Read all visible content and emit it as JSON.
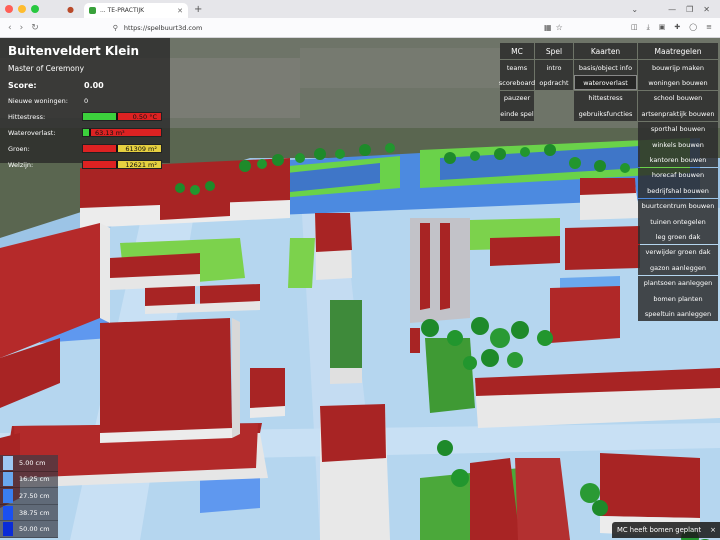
{
  "browser": {
    "tab_title": "  ...  TE-PRACTIJK",
    "url": "https://spelbuurt3d.com",
    "new_tab": "+",
    "back": "‹",
    "forward": "›",
    "reload": "↻"
  },
  "info": {
    "title": "Buitenveldert Klein",
    "role": "Master of Ceremony",
    "score_label": "Score:",
    "score_value": "0.00",
    "woningen_label": "Nieuwe woningen:",
    "woningen_value": "0",
    "hittestress_label": "Hittestress:",
    "hittestress_value": "0.50 °C",
    "hittestress_fill": 0.45,
    "wateroverlast_label": "Wateroverlast:",
    "wateroverlast_value": "63.13 m³",
    "wateroverlast_fill": 0.1,
    "groen_label": "Groen:",
    "groen_value": "61309 m²",
    "groen_fill": 0.45,
    "welzijn_label": "Welzijn:",
    "welzijn_value": "12621 m²",
    "welzijn_fill": 0.45
  },
  "menu": {
    "headers": [
      "MC",
      "Spel",
      "Kaarten",
      "Maatregelen"
    ],
    "mc": [
      "teams",
      "scoreboard",
      "pauzeer",
      "einde spel"
    ],
    "spel": [
      "intro",
      "opdracht"
    ],
    "kaarten": [
      "basis/object info",
      "wateroverlast",
      "hittestress",
      "gebruiksfuncties"
    ],
    "kaarten_selected": "wateroverlast",
    "maatregelen": [
      "bouwrijp maken",
      "woningen bouwen",
      "school bouwen",
      "artsenpraktijk bouwen",
      "sporthal bouwen",
      "winkels bouwen",
      "kantoren bouwen",
      "horecaf bouwen",
      "bedrijfshal bouwen",
      "buurtcentrum bouwen",
      "tuinen ontegelen",
      "leg groen dak",
      "verwijder groen dak",
      "gazon aanleggen",
      "plantsoen aanleggen",
      "bomen planten",
      "speeltuin aanleggen"
    ]
  },
  "legend": [
    {
      "label": "5.00 cm",
      "color": "#9ec8f2"
    },
    {
      "label": "16.25 cm",
      "color": "#6aa8ee"
    },
    {
      "label": "27.50 cm",
      "color": "#3a7ef0"
    },
    {
      "label": "38.75 cm",
      "color": "#1a50f0"
    },
    {
      "label": "50.00 cm",
      "color": "#0a2cd8"
    }
  ],
  "toast": {
    "text": "MC heeft bomen geplant",
    "close": "×"
  },
  "colors": {
    "roof_red": "#a82424",
    "water_light": "#a8d0ee",
    "grass": "#6fd04a",
    "tree": "#1e8a2a"
  }
}
